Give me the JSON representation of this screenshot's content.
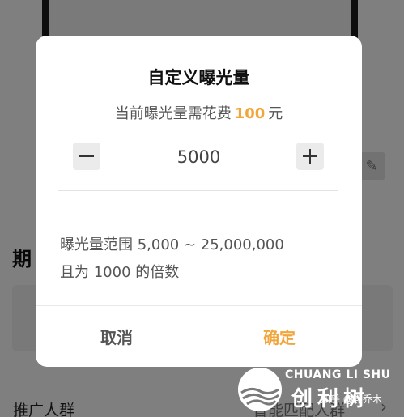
{
  "background": {
    "section_title": "期",
    "audience_label": "推广人群",
    "audience_value": "智能匹配人群",
    "edit_icon": "pencil-icon",
    "chevron_icon": "chevron-right-icon"
  },
  "dialog": {
    "title": "自定义曝光量",
    "cost_prefix": "当前曝光量需花费",
    "cost_amount": "100",
    "cost_unit": "元",
    "stepper_value": "5000",
    "range_text": "曝光量范围 5,000 ~ 25,000,000",
    "multiple_text": "且为 1000 的倍数",
    "cancel_label": "取消",
    "confirm_label": "确定",
    "accent_color": "#f2a53a"
  },
  "watermark": {
    "brand_en": "CHUANG LI SHU",
    "brand_cn": "创利树",
    "credit": "知乎 @野乔木"
  }
}
